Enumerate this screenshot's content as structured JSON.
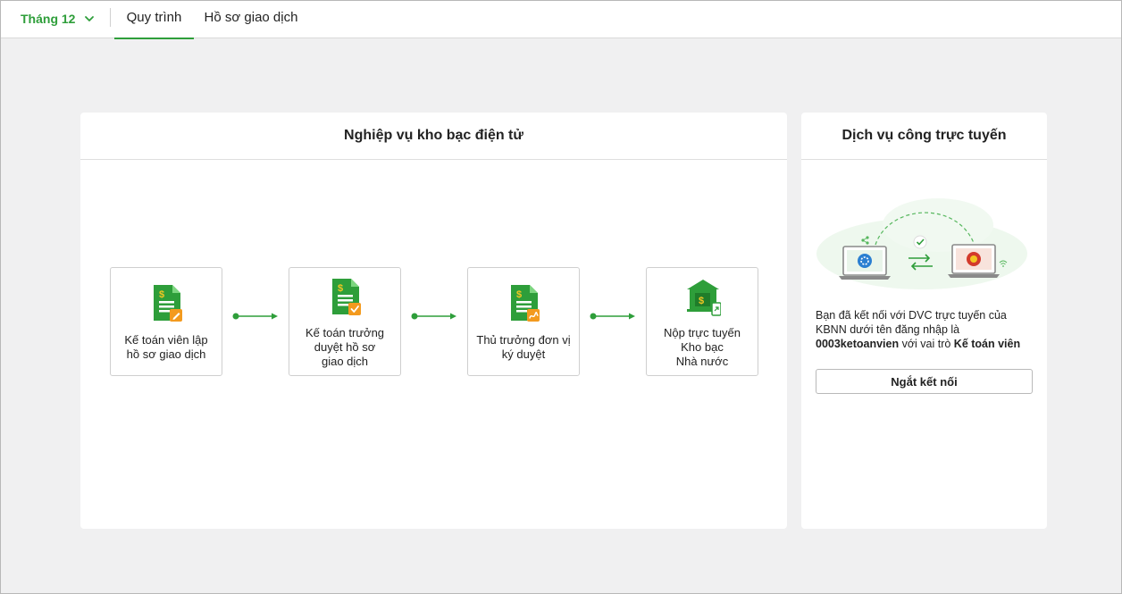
{
  "header": {
    "month_label": "Tháng 12",
    "tabs": [
      {
        "label": "Quy trình",
        "active": true
      },
      {
        "label": "Hồ sơ giao dịch",
        "active": false
      }
    ]
  },
  "treasury": {
    "title": "Nghiệp vụ kho bạc điện tử",
    "steps": [
      {
        "label": "Kế toán viên lập\nhồ sơ giao dịch",
        "icon": "document-dollar-edit-icon"
      },
      {
        "label": "Kế toán trưởng\nduyệt hồ sơ\ngiao dịch",
        "icon": "document-dollar-check-icon"
      },
      {
        "label": "Thủ trưởng đơn vị\nký duyệt",
        "icon": "document-dollar-sign-icon"
      },
      {
        "label": "Nộp trực tuyến\nKho bạc\nNhà nước",
        "icon": "bank-upload-icon"
      }
    ]
  },
  "online_service": {
    "title": "Dịch vụ công trực tuyến",
    "text_prefix": "Bạn đã kết nối với DVC trực tuyến của KBNN dưới tên đăng nhập là ",
    "username": "0003ketoanvien",
    "text_middle": " với vai trò ",
    "role": "Kế toán viên",
    "disconnect_label": "Ngắt kết nối"
  },
  "colors": {
    "brand_green": "#2e9e3a",
    "accent_orange": "#f39a1e"
  }
}
